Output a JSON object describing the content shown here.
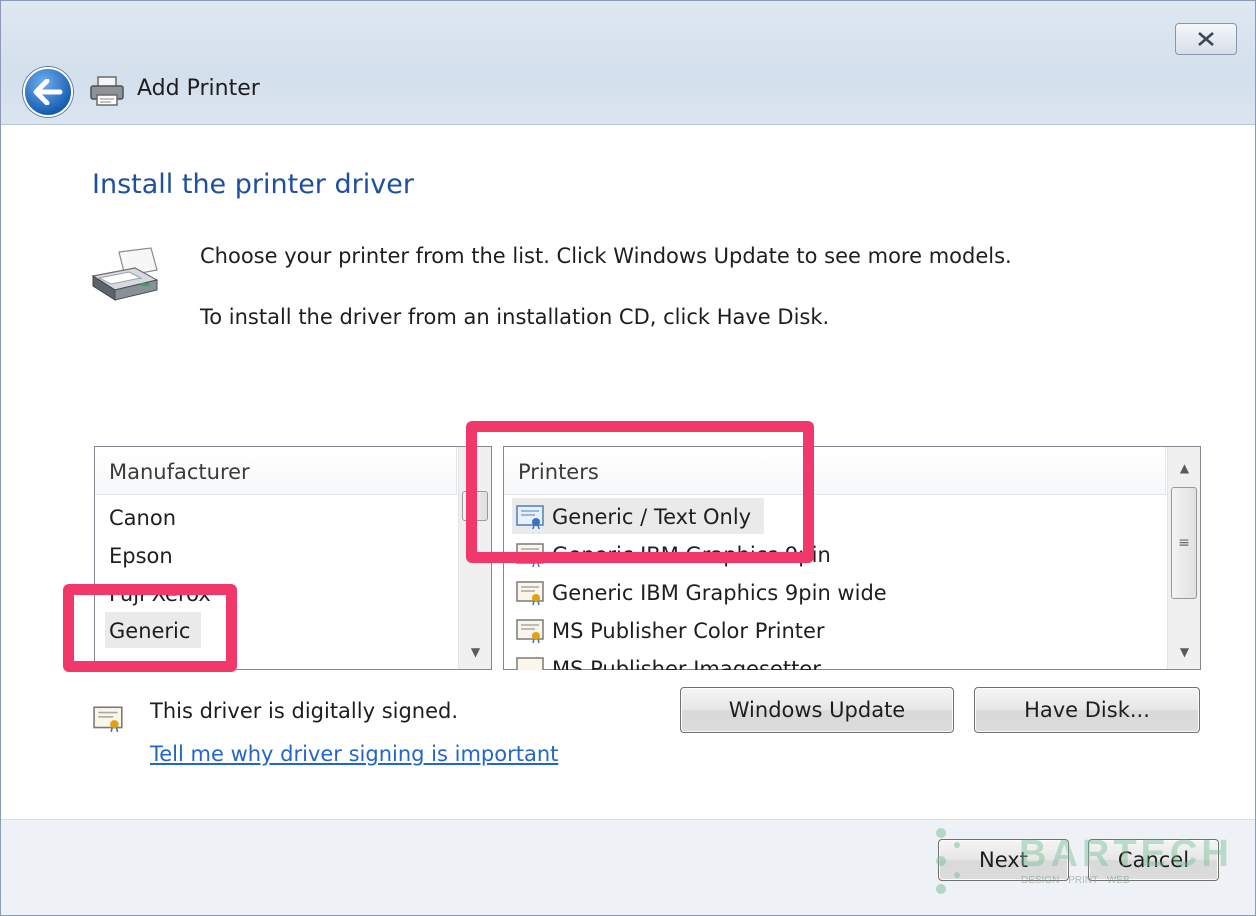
{
  "window": {
    "title": "Add Printer",
    "close_glyph": "✕"
  },
  "page": {
    "heading": "Install the printer driver",
    "instruction_1": "Choose your printer from the list. Click Windows Update to see more models.",
    "instruction_2": "To install the driver from an installation CD, click Have Disk."
  },
  "manufacturer_list": {
    "header": "Manufacturer",
    "items": [
      "Canon",
      "Epson",
      "Fuji Xerox",
      "Generic"
    ],
    "selected": "Generic"
  },
  "printers_list": {
    "header": "Printers",
    "items": [
      "Generic / Text Only",
      "Generic IBM Graphics 9pin",
      "Generic IBM Graphics 9pin wide",
      "MS Publisher Color Printer",
      "MS Publisher Imagesetter"
    ],
    "selected": "Generic / Text Only"
  },
  "signing": {
    "status": "This driver is digitally signed.",
    "link": "Tell me why driver signing is important"
  },
  "buttons": {
    "windows_update": "Windows Update",
    "have_disk": "Have Disk...",
    "next": "Next",
    "cancel": "Cancel"
  },
  "icons": {
    "back": "back-arrow-icon",
    "title_printer": "printer-icon",
    "large_printer": "printer-icon",
    "certificate": "certificate-icon"
  },
  "colors": {
    "heading": "#1f4fa0",
    "link": "#2366c8",
    "highlight": "#f0386b"
  },
  "watermark": {
    "brand": "BARTECH",
    "tagline": "DESIGN · PRINT · WEB"
  }
}
